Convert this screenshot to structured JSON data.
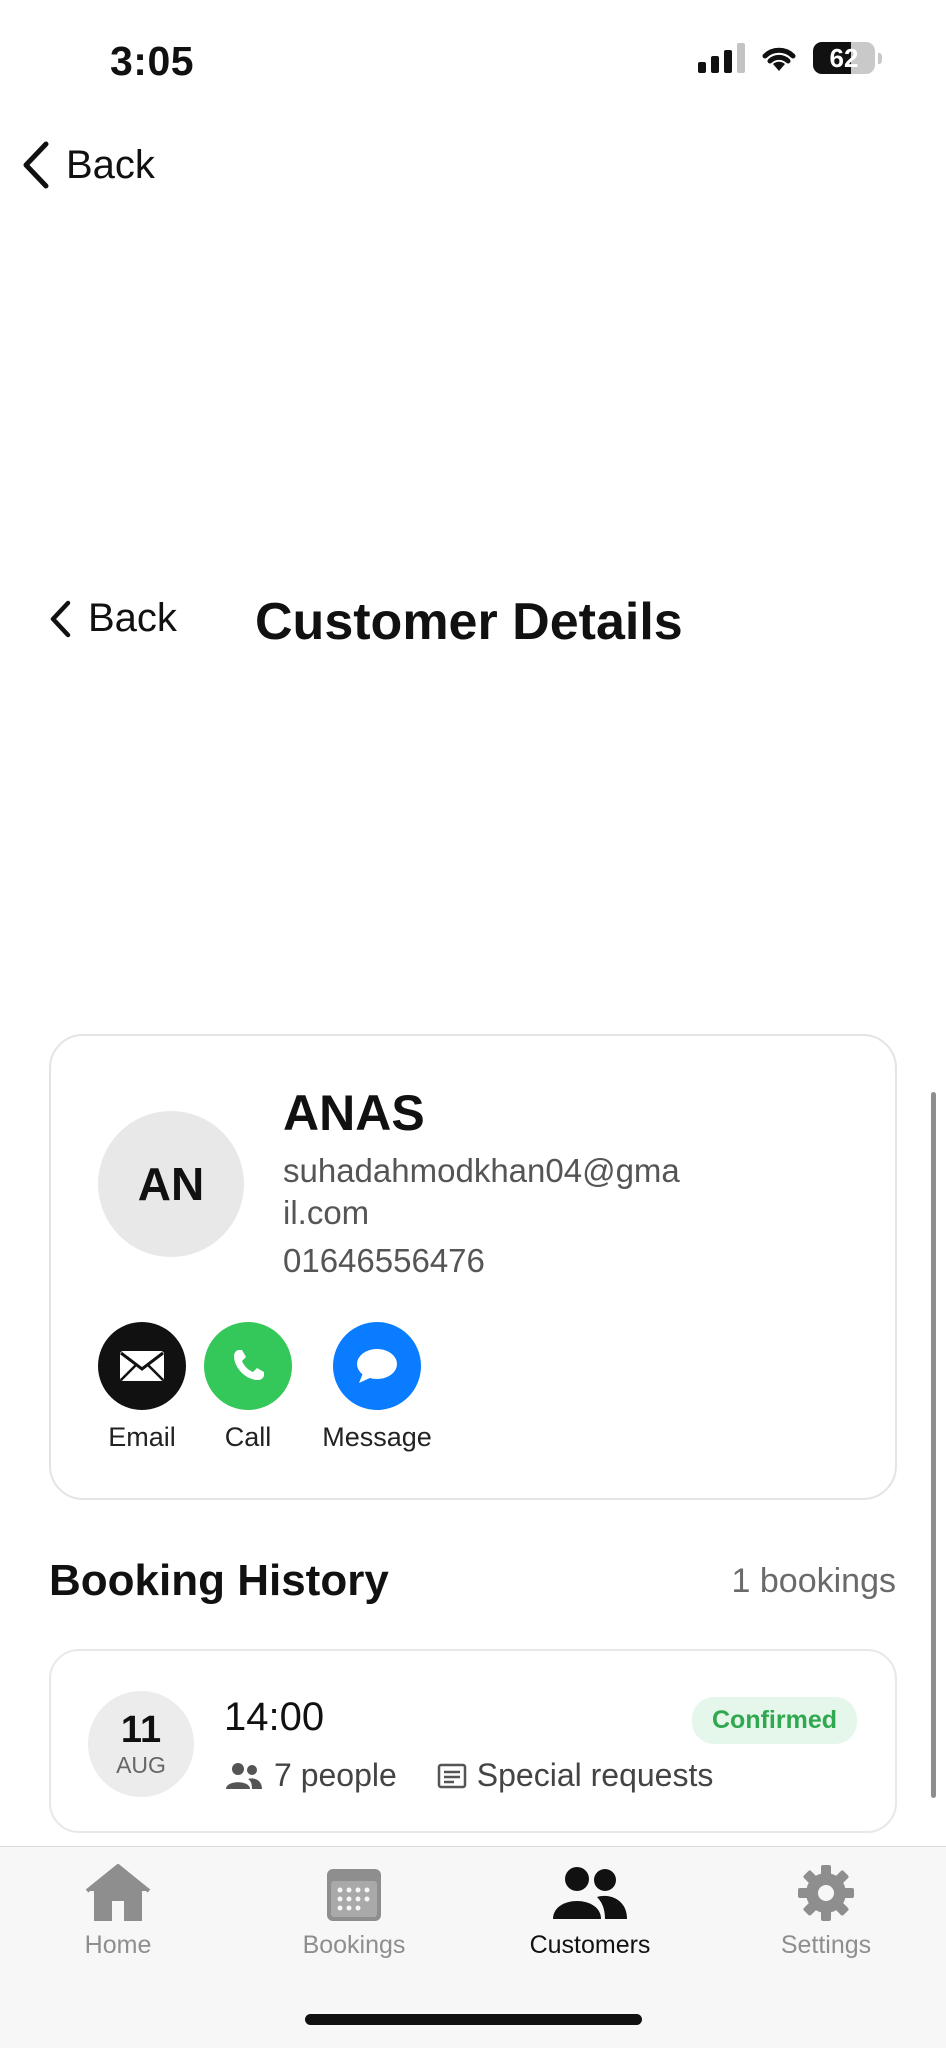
{
  "status_bar": {
    "time": "3:05",
    "battery": "62"
  },
  "nav": {
    "back_label": "Back"
  },
  "header": {
    "back_label": "Back",
    "title": "Customer Details"
  },
  "customer": {
    "initials": "AN",
    "name": "ANAS",
    "email": "suhadahmodkhan04@gmail.com",
    "phone": "01646556476",
    "actions": [
      {
        "label": "Email",
        "icon": "envelope-icon",
        "color": "#111111"
      },
      {
        "label": "Call",
        "icon": "phone-icon",
        "color": "#34c759"
      },
      {
        "label": "Message",
        "icon": "chat-bubble-icon",
        "color": "#0a7cff"
      }
    ]
  },
  "booking_history": {
    "title": "Booking History",
    "count": "1 bookings",
    "items": [
      {
        "day": "11",
        "month": "AUG",
        "time": "14:00",
        "people": "7 people",
        "notes": "Special requests",
        "status": "Confirmed",
        "status_color": "#2fa84f"
      }
    ]
  },
  "tabbar": {
    "tabs": [
      {
        "label": "Home",
        "icon": "house-icon"
      },
      {
        "label": "Bookings",
        "icon": "calendar-icon"
      },
      {
        "label": "Customers",
        "icon": "people-icon",
        "active": true
      },
      {
        "label": "Settings",
        "icon": "gear-icon"
      }
    ]
  }
}
